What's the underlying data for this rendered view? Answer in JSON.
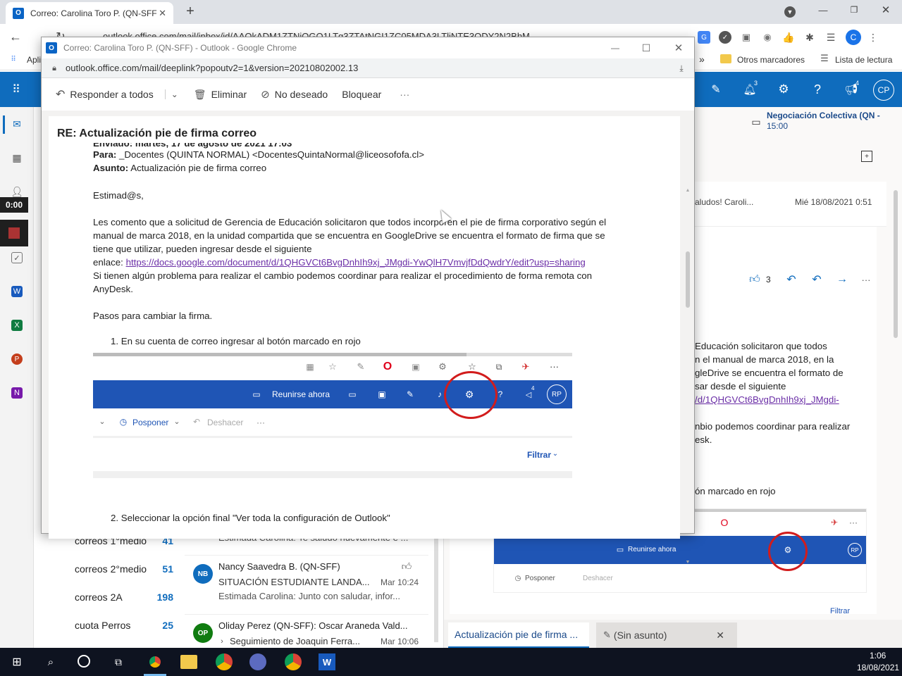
{
  "browser": {
    "tab_title": "Correo: Carolina Toro P. (QN-SFF",
    "url": "outlook.office.com/mail/inbox/id/AAQkADM1ZTNjOGQ1LTg3ZTAtNGI1ZC05MDA3LTliNTE3ODY2N2BhM...",
    "apps_label": "Apli",
    "otros_marcadores": "Otros marcadores",
    "lista_lectura": "Lista de lectura",
    "more_chevron": "»",
    "profile_initial": "C"
  },
  "owa": {
    "notif_count": "3",
    "megaphone_count": "4",
    "avatar": "CP",
    "timer": "0:00",
    "event_title": "Negociación Colectiva (QN -",
    "event_time": "15:00",
    "preview_snippet": "aludos! Caroli...",
    "preview_date": "Mié 18/08/2021 0:51",
    "likes": "3",
    "body_fragments": [
      "Educación solicitaron que todos",
      "n el manual de marca 2018, en la",
      "gleDrive se encuentra el formato de",
      "sar desde el siguiente",
      "/d/1QHGVCt6BvgDnhIh9xj_JMgdi-",
      "nbio podemos coordinar para realizar",
      "esk.",
      "ón marcado en rojo"
    ],
    "compose_tabs": [
      {
        "label": "Actualización pie de firma ..."
      },
      {
        "label": "(Sin asunto)"
      }
    ],
    "folders": [
      {
        "name": "correos 1°medio",
        "count": "41"
      },
      {
        "name": "correos 2°medio",
        "count": "51"
      },
      {
        "name": "correos 2A",
        "count": "198"
      },
      {
        "name": "cuota Perros",
        "count": "25"
      }
    ],
    "messages": [
      {
        "initials": "",
        "sender": "",
        "subject": "",
        "time": "",
        "preview": "Estimada Carolina: Te saludo nuevamente e ...",
        "color": "#8a8886"
      },
      {
        "initials": "NB",
        "sender": "Nancy Saavedra B. (QN-SFF)",
        "subject": "SITUACIÓN ESTUDIANTE LANDA...",
        "time": "Mar 10:24",
        "preview": "Estimada Carolina: Junto con saludar, infor...",
        "color": "#0f6cbd"
      },
      {
        "initials": "OP",
        "sender": "Oliday Perez (QN-SFF): Oscar Araneda Vald...",
        "subject": "Seguimiento de Joaquin Ferra...",
        "time": "Mar 10:06",
        "preview": "",
        "color": "#107c10"
      }
    ]
  },
  "popup": {
    "window_title": "Correo: Carolina Toro P. (QN-SFF) - Outlook - Google Chrome",
    "url": "outlook.office.com/mail/deeplink?popoutv2=1&version=20210802002.13",
    "toolbar": {
      "reply_all": "Responder a todos",
      "delete": "Eliminar",
      "junk": "No deseado",
      "block": "Bloquear",
      "more": "···"
    },
    "subject": "RE: Actualización pie de firma correo",
    "clipped_line": "Enviado: martes, 17 de agosto de 2021 17:03",
    "to_label": "Para:",
    "to_value": " _Docentes (QUINTA NORMAL) <DocentesQuintaNormal@liceosofofa.cl>",
    "subject_label": "Asunto:",
    "subject_value": " Actualización pie de firma correo",
    "greeting": "Estimad@s,",
    "para1": [
      "Les comento que a solicitud de Gerencia de Educación solicitaron que todos incorporen el pie de firma corporativo según el",
      "manual de marca 2018, en la unidad compartida que se encuentra en GoogleDrive se encuentra el formato de firma que se",
      "tiene que utilizar, pueden ingresar desde el siguiente"
    ],
    "link_prefix": "enlace: ",
    "link": "https://docs.google.com/document/d/1QHGVCt6BvgDnhIh9xj_JMgdi-YwQlH7VmvjfDdQwdrY/edit?usp=sharing",
    "para2": [
      "Si tienen algún problema para realizar el cambio podemos coordinar para realizar el procedimiento de forma remota con",
      "AnyDesk."
    ],
    "steps_title": "Pasos para cambiar la firma.",
    "step1": "1. En su cuenta de correo ingresar al botón marcado en rojo",
    "step2": "2. Seleccionar la opción final \"Ver toda la configuración de Outlook\"",
    "shot": {
      "reunirse": "Reunirse ahora",
      "posponer": "Posponer",
      "deshacer": "Deshacer",
      "filtrar": "Filtrar",
      "avatar": "RP",
      "badge": "4",
      "more": "···"
    }
  },
  "taskbar": {
    "time": "1:06",
    "date": "18/08/2021"
  }
}
